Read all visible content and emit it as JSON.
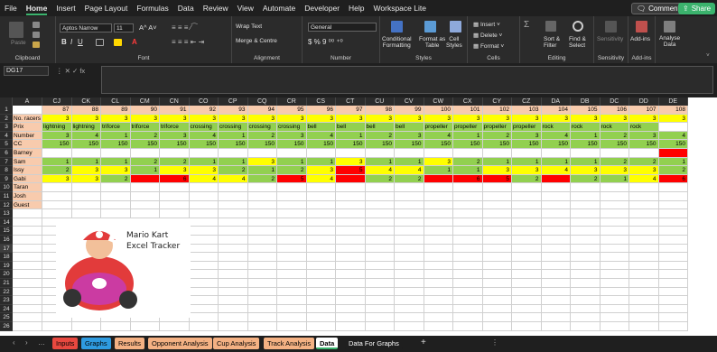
{
  "menu": [
    "File",
    "Home",
    "Insert",
    "Page Layout",
    "Formulas",
    "Data",
    "Review",
    "View",
    "Automate",
    "Developer",
    "Help",
    "Workspace Lite"
  ],
  "menu_active": "Home",
  "top_buttons": {
    "comments": "Comments",
    "share": "Share"
  },
  "ribbon": {
    "clipboard": {
      "label": "Clipboard",
      "paste": "Paste"
    },
    "font": {
      "label": "Font",
      "name": "Aptos Narrow",
      "size": "11"
    },
    "alignment": {
      "label": "Alignment",
      "wrap": "Wrap Text",
      "merge": "Merge & Centre"
    },
    "number": {
      "label": "Number",
      "format": "General"
    },
    "styles": {
      "label": "Styles",
      "cond": "Conditional\nFormatting",
      "table": "Format as\nTable",
      "cell": "Cell\nStyles"
    },
    "cells": {
      "label": "Cells",
      "insert": "Insert",
      "delete": "Delete",
      "format": "Format"
    },
    "editing": {
      "label": "Editing",
      "sort": "Sort &\nFilter",
      "find": "Find &\nSelect"
    },
    "sensitivity": {
      "label": "Sensitivity",
      "btn": "Sensitivity"
    },
    "addins": {
      "label": "Add-ins",
      "btn": "Add-ins"
    },
    "analyse": {
      "btn": "Analyse\nData"
    }
  },
  "namebox": "DG17",
  "columns": [
    "A",
    "CJ",
    "CK",
    "CL",
    "CM",
    "CN",
    "CO",
    "CP",
    "CQ",
    "CR",
    "CS",
    "CT",
    "CU",
    "CV",
    "CW",
    "CX",
    "CY",
    "CZ",
    "DA",
    "DB",
    "DC",
    "DD",
    "DE"
  ],
  "row_numbers": [
    "1",
    "2",
    "3",
    "4",
    "5",
    "6",
    "7",
    "8",
    "9",
    "10",
    "11",
    "12",
    "13",
    "14",
    "15",
    "16",
    "17",
    "18",
    "19",
    "20",
    "21",
    "22",
    "23",
    "24",
    "25",
    "26"
  ],
  "rows": {
    "r1": [
      "",
      "87",
      "88",
      "89",
      "90",
      "91",
      "92",
      "93",
      "94",
      "95",
      "96",
      "97",
      "98",
      "99",
      "100",
      "101",
      "102",
      "103",
      "104",
      "105",
      "106",
      "107",
      "108"
    ],
    "r2": [
      "No. racers",
      "3",
      "3",
      "3",
      "3",
      "3",
      "3",
      "3",
      "3",
      "3",
      "3",
      "3",
      "3",
      "3",
      "3",
      "3",
      "3",
      "3",
      "3",
      "3",
      "3",
      "3",
      "3"
    ],
    "r3": [
      "Prix",
      "lightning",
      "lightning",
      "triforce",
      "triforce",
      "triforce",
      "crossing",
      "crossing",
      "crossing",
      "crossing",
      "bell",
      "bell",
      "bell",
      "bell",
      "propeller",
      "propeller",
      "propeller",
      "propeller",
      "rock",
      "rock",
      "rock",
      "rock",
      ""
    ],
    "r4": [
      "Number",
      "3",
      "4",
      "1",
      "2",
      "3",
      "4",
      "1",
      "2",
      "3",
      "4",
      "1",
      "2",
      "3",
      "4",
      "1",
      "2",
      "3",
      "4",
      "1",
      "2",
      "3",
      "4"
    ],
    "r5": [
      "CC",
      "150",
      "150",
      "150",
      "150",
      "150",
      "150",
      "150",
      "150",
      "150",
      "150",
      "150",
      "150",
      "150",
      "150",
      "150",
      "150",
      "150",
      "150",
      "150",
      "150",
      "150",
      "150"
    ],
    "r6": [
      "Barney",
      "",
      "",
      "",
      "",
      "",
      "",
      "",
      "",
      "",
      "",
      "",
      "",
      "",
      "",
      "",
      "",
      "",
      "",
      "",
      "",
      "",
      ""
    ],
    "r7": [
      "Sam",
      "1",
      "1",
      "1",
      "2",
      "2",
      "1",
      "1",
      "3",
      "1",
      "1",
      "3",
      "1",
      "1",
      "3",
      "2",
      "1",
      "1",
      "1",
      "1",
      "2",
      "2",
      "1"
    ],
    "r8": [
      "Issy",
      "2",
      "3",
      "3",
      "1",
      "3",
      "3",
      "2",
      "1",
      "2",
      "3",
      "5",
      "4",
      "4",
      "1",
      "1",
      "3",
      "3",
      "4",
      "3",
      "3",
      "3",
      "2"
    ],
    "r9": [
      "Gabi",
      "3",
      "3",
      "2",
      "",
      "6",
      "4",
      "4",
      "2",
      "5",
      "4",
      "",
      "2",
      "2",
      "",
      "6",
      "5",
      "2",
      "",
      "2",
      "1",
      "4",
      "6"
    ],
    "r10": [
      "Taran"
    ],
    "r11": [
      "Josh"
    ],
    "r12": [
      "Guest"
    ]
  },
  "logo_text": [
    "Mario Kart",
    "Excel Tracker"
  ],
  "sheet_tabs": [
    {
      "label": "Inputs",
      "color": "#e8483f"
    },
    {
      "label": "Graphs",
      "color": "#2e9be0"
    },
    {
      "label": "Results",
      "color": "#f4b183"
    },
    {
      "label": "Opponent Analysis",
      "color": "#f4b183"
    },
    {
      "label": "Cup Analysis",
      "color": "#f4b183"
    },
    {
      "label": "Track Analysis",
      "color": "#f4b183"
    },
    {
      "label": "Data",
      "color": "#ffffff"
    },
    {
      "label": "Data For Graphs",
      "color": "#1f1f1f"
    }
  ],
  "colors": {
    "header_salmon": "#f8cbad",
    "yellow": "#ffff00",
    "green": "#92d050",
    "red": "#ff0000",
    "accent": "#3bb36d"
  }
}
